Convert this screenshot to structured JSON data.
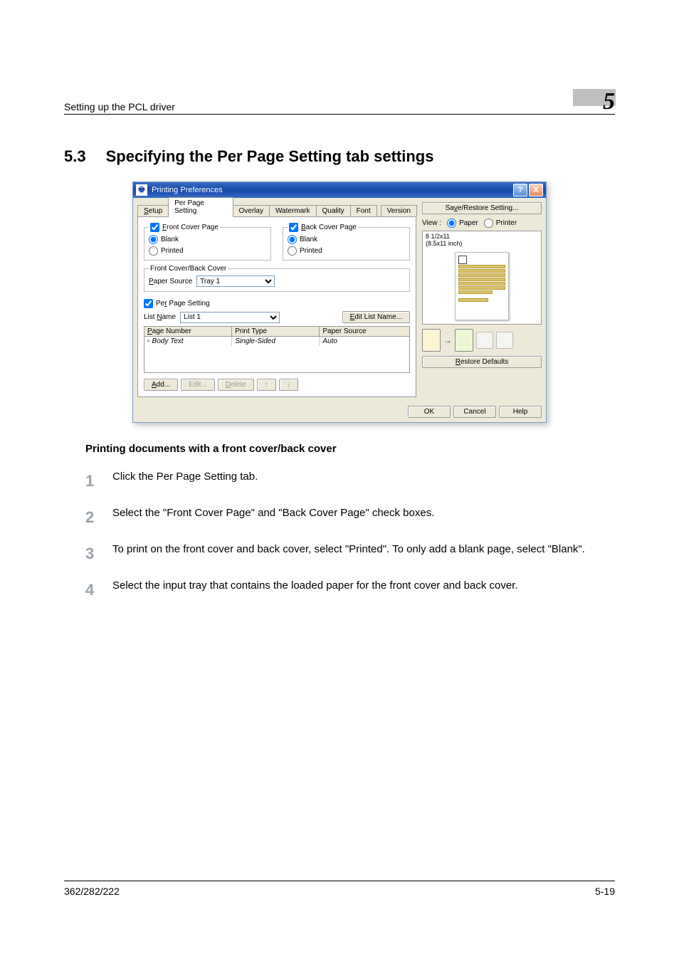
{
  "page": {
    "header_title": "Setting up the PCL driver",
    "chapter_number": "5",
    "section_number": "5.3",
    "section_title": "Specifying the Per Page Setting tab settings",
    "footer_left": "362/282/222",
    "footer_right": "5-19"
  },
  "dialog": {
    "title": "Printing Preferences",
    "title_icon_letter": "",
    "help_glyph": "?",
    "close_glyph": "X",
    "tabs": {
      "setup": "Setup",
      "per_page_setting": "Per Page Setting",
      "overlay": "Overlay",
      "watermark": "Watermark",
      "quality": "Quality",
      "font": "Font",
      "version": "Version"
    },
    "front_cover": {
      "legend": "Front Cover Page",
      "blank": "Blank",
      "printed": "Printed"
    },
    "back_cover": {
      "legend": "Back Cover Page",
      "blank": "Blank",
      "printed": "Printed"
    },
    "fcbc": {
      "legend": "Front Cover/Back Cover",
      "paper_source_label": "Paper Source",
      "paper_source_value": "Tray 1"
    },
    "per_page_setting": {
      "checkbox_label": "Per Page Setting",
      "list_name_label": "List Name",
      "list_name_value": "List 1",
      "edit_list_name_btn": "Edit List Name..."
    },
    "list": {
      "col_page_number": "Page Number",
      "col_print_type": "Print Type",
      "col_paper_source": "Paper Source",
      "row_page": "Body Text",
      "row_type": "Single-Sided",
      "row_source": "Auto"
    },
    "buttons": {
      "add": "Add...",
      "edit": "Edit...",
      "delete": "Delete",
      "up": "↑",
      "down": "↓"
    },
    "right": {
      "save_restore": "Save/Restore Setting...",
      "view_label": "View :",
      "view_paper": "Paper",
      "view_printer": "Printer",
      "size_line1": "8 1/2x11",
      "size_line2": "(8.5x11 inch)",
      "restore_defaults": "Restore Defaults"
    },
    "footer": {
      "ok": "OK",
      "cancel": "Cancel",
      "help": "Help"
    }
  },
  "body": {
    "subheading": "Printing documents with a front cover/back cover",
    "steps": [
      "Click the Per Page Setting tab.",
      "Select the \"Front Cover Page\" and \"Back Cover Page\" check boxes.",
      "To print on the front cover and back cover, select \"Printed\". To only add a blank page, select \"Blank\".",
      "Select the input tray that contains the loaded paper for the front cover and back cover."
    ],
    "step_numbers": [
      "1",
      "2",
      "3",
      "4"
    ]
  }
}
